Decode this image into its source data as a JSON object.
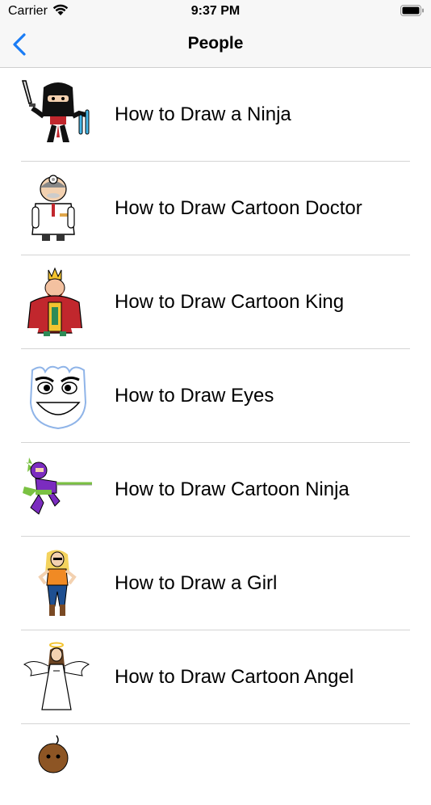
{
  "status": {
    "carrier": "Carrier",
    "time": "9:37 PM"
  },
  "nav": {
    "title": "People"
  },
  "rows": [
    {
      "label": "How to Draw a Ninja",
      "icon": "ninja-icon"
    },
    {
      "label": "How to Draw Cartoon Doctor",
      "icon": "doctor-icon"
    },
    {
      "label": "How to Draw Cartoon King",
      "icon": "king-icon"
    },
    {
      "label": "How to Draw Eyes",
      "icon": "eyes-icon"
    },
    {
      "label": "How to Draw Cartoon Ninja",
      "icon": "cartoon-ninja-icon"
    },
    {
      "label": "How to Draw a Girl",
      "icon": "girl-icon"
    },
    {
      "label": "How to Draw Cartoon Angel",
      "icon": "angel-icon"
    },
    {
      "label": "",
      "icon": "baby-icon"
    }
  ],
  "colors": {
    "accent": "#1a7cf5",
    "separator": "#d4d4d4",
    "bar": "#f7f7f7"
  }
}
